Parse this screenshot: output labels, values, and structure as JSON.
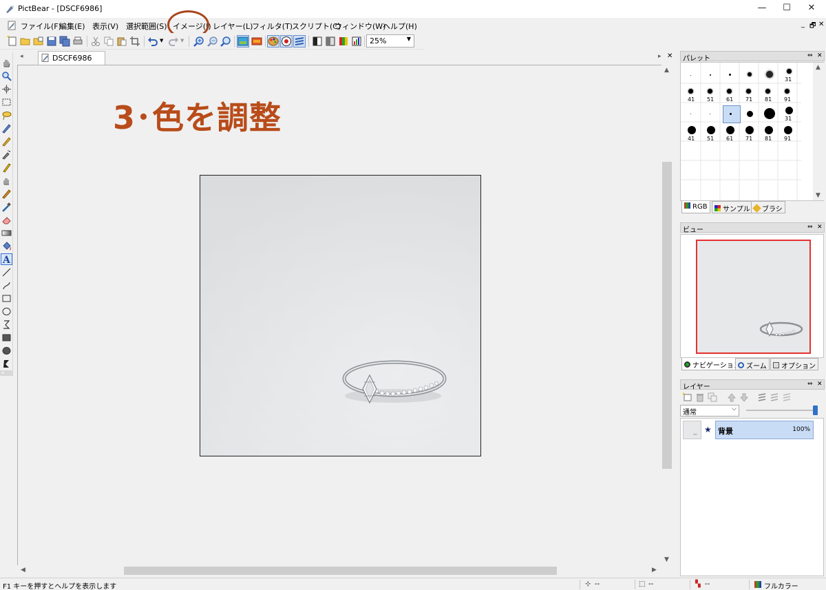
{
  "window": {
    "title": "PictBear - [DSCF6986]",
    "controls": {
      "minimize": "—",
      "maximize": "☐",
      "close": "✕"
    }
  },
  "menu": {
    "items": [
      "ファイル(F)",
      "編集(E)",
      "表示(V)",
      "選択範囲(S)",
      "イメージ(I)",
      "レイヤー(L)",
      "フィルタ(T)",
      "スクリプト(C)",
      "ウィンドウ(W)",
      "ヘルプ(H)"
    ],
    "mdi_controls": {
      "minimize": "_",
      "restore": "🗗",
      "close": "✕"
    }
  },
  "toolbar": {
    "zoom_value": "25%"
  },
  "document": {
    "tab_label": "DSCF6986",
    "annotation": "3･色を調整"
  },
  "panels": {
    "palette": {
      "title": "パレット",
      "brush_sizes_row2": [
        "41",
        "51",
        "61",
        "71",
        "81",
        "91"
      ],
      "brush_sizes_row1_last": "31",
      "brush_sizes_row3_last": "31",
      "brush_sizes_row4": [
        "41",
        "51",
        "61",
        "71",
        "81",
        "91"
      ],
      "tabs": [
        "RGB",
        "サンプル",
        "ブラシ"
      ]
    },
    "view": {
      "title": "ビュー",
      "tabs": [
        "ナビゲーション",
        "ズーム",
        "オプション"
      ]
    },
    "layer": {
      "title": "レイヤー",
      "blend_mode": "通常",
      "layers": [
        {
          "name": "背景",
          "opacity": "100%"
        }
      ]
    }
  },
  "statusbar": {
    "help_text": "F1 キーを押すとヘルプを表示します",
    "pos_value": "--",
    "size_value": "--",
    "color_value": "--",
    "color_mode": "フルカラー"
  },
  "colors": {
    "annotation": "#b84c1a",
    "accent_blue": "#2d72c8",
    "view_frame": "#e53030"
  }
}
